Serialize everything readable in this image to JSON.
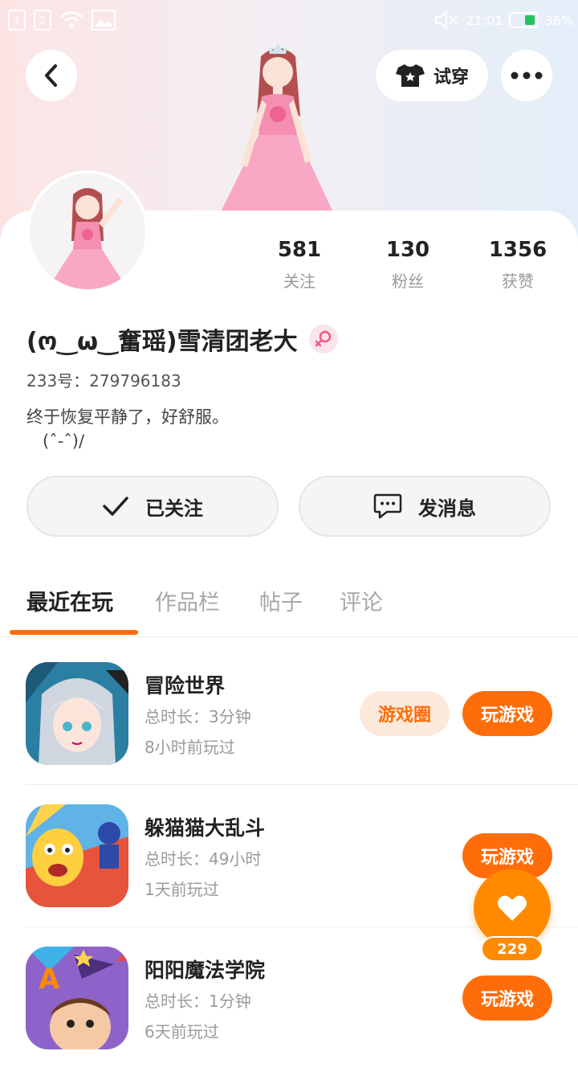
{
  "status_bar": {
    "sim1": "1",
    "sim2": "2",
    "time": "21:01",
    "battery": "36%"
  },
  "header": {
    "try_on_label": "试穿"
  },
  "profile": {
    "stats": [
      {
        "value": "581",
        "label": "关注"
      },
      {
        "value": "130",
        "label": "粉丝"
      },
      {
        "value": "1356",
        "label": "获赞"
      }
    ],
    "name": "(ო‿ω‿奮瑶)雪清团老大",
    "uid": "233号：279796183",
    "bio": "终于恢复平静了，好舒服。\n   (ˆ-ˆ)/"
  },
  "actions": {
    "followed_label": "已关注",
    "message_label": "发消息"
  },
  "tabs": [
    "最近在玩",
    "作品栏",
    "帖子",
    "评论"
  ],
  "games": [
    {
      "title": "冒险世界",
      "duration": "总时长：3分钟",
      "last_played": "8小时前玩过",
      "circle_label": "游戏圈",
      "play_label": "玩游戏"
    },
    {
      "title": "躲猫猫大乱斗",
      "duration": "总时长：49小时",
      "last_played": "1天前玩过",
      "play_label": "玩游戏"
    },
    {
      "title": "阳阳魔法学院",
      "duration": "总时长：1分钟",
      "last_played": "6天前玩过",
      "play_label": "玩游戏"
    }
  ],
  "like_fab": {
    "count": "229"
  },
  "colors": {
    "accent": "#ff6d0a",
    "fab": "#ff8a00"
  }
}
